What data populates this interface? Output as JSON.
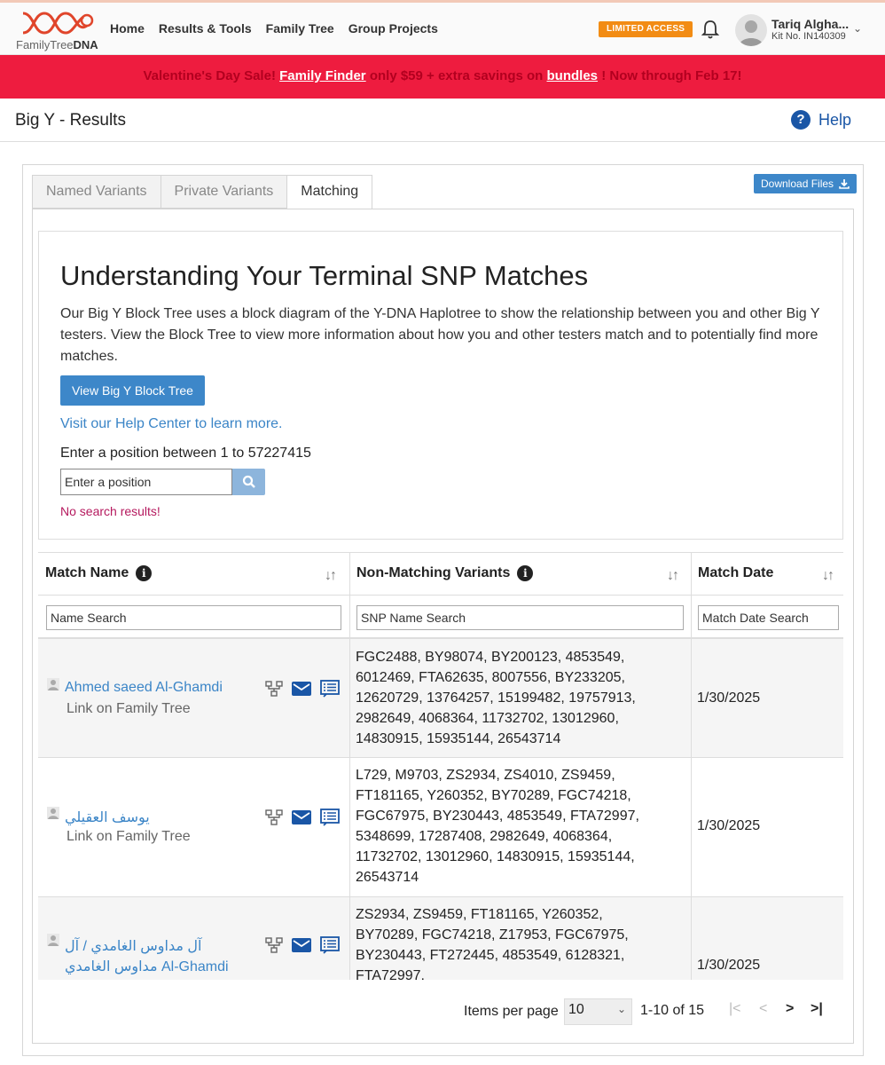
{
  "brand": {
    "logo_text_prefix": "FamilyTree",
    "logo_text_suffix": "DNA"
  },
  "nav": [
    "Home",
    "Results & Tools",
    "Family Tree",
    "Group Projects"
  ],
  "access_badge": "LIMITED ACCESS",
  "user": {
    "name": "Tariq Algha...",
    "kit": "Kit No. IN140309"
  },
  "promo": {
    "part1": "Valentine's Day Sale!",
    "link1": "Family Finder",
    "part2": "only $59 + extra savings on",
    "link2": "bundles",
    "part3": "! Now through Feb 17!"
  },
  "page": {
    "title": "Big Y - Results",
    "help": "Help"
  },
  "tabs": [
    "Named Variants",
    "Private Variants",
    "Matching"
  ],
  "active_tab": "Matching",
  "download_label": "Download Files",
  "intro": {
    "heading": "Understanding Your Terminal SNP Matches",
    "body": "Our Big Y Block Tree uses a block diagram of the Y-DNA Haplotree to show the relationship between you and other Big Y testers. View the Block Tree to view more information about how you and other testers match and to potentially find more matches.",
    "tree_button": "View Big Y Block Tree",
    "help_link": "Visit our Help Center to learn more.",
    "position_label": "Enter a position between 1 to 57227415",
    "position_placeholder": "Enter a position",
    "no_results": "No search results!"
  },
  "table": {
    "columns": {
      "match_name": "Match Name",
      "variants": "Non-Matching Variants",
      "date": "Match Date"
    },
    "filters": {
      "name": "Name Search",
      "snp": "SNP Name Search",
      "date": "Match Date Search"
    },
    "rows": [
      {
        "name": "Ahmed saeed Al-Ghamdi",
        "link": "Link on Family Tree",
        "variants": "FGC2488, BY98074, BY200123, 4853549, 6012469, FTA62635, 8007556, BY233205, 12620729, 13764257, 15199482, 19757913, 2982649, 4068364, 11732702, 13012960, 14830915, 15935144, 26543714",
        "date": "1/30/2025"
      },
      {
        "name": "يوسف العقيلي",
        "link": "Link on Family Tree",
        "variants": "L729, M9703, ZS2934, ZS4010, ZS9459, FT181165, Y260352, BY70289, FGC74218, FGC67975, BY230443, 4853549, FTA72997, 5348699, 17287408, 2982649, 4068364, 11732702, 13012960, 14830915, 15935144, 26543714",
        "date": "1/30/2025"
      },
      {
        "name": "آل مداوس الغامدي / آل مداوس الغامدي Al-Ghamdi",
        "link": "",
        "variants": "ZS2934, ZS9459, FT181165, Y260352, BY70289, FGC74218, Z17953, FGC67975, BY230443, FT272445, 4853549, 6128321, FTA72997,",
        "date": "1/30/2025"
      }
    ]
  },
  "pagination": {
    "items_per_page_label": "Items per page",
    "items_per_page": "10",
    "range": "1-10 of 15",
    "first": "|<",
    "prev": "<",
    "next": ">",
    "last": ">|"
  }
}
